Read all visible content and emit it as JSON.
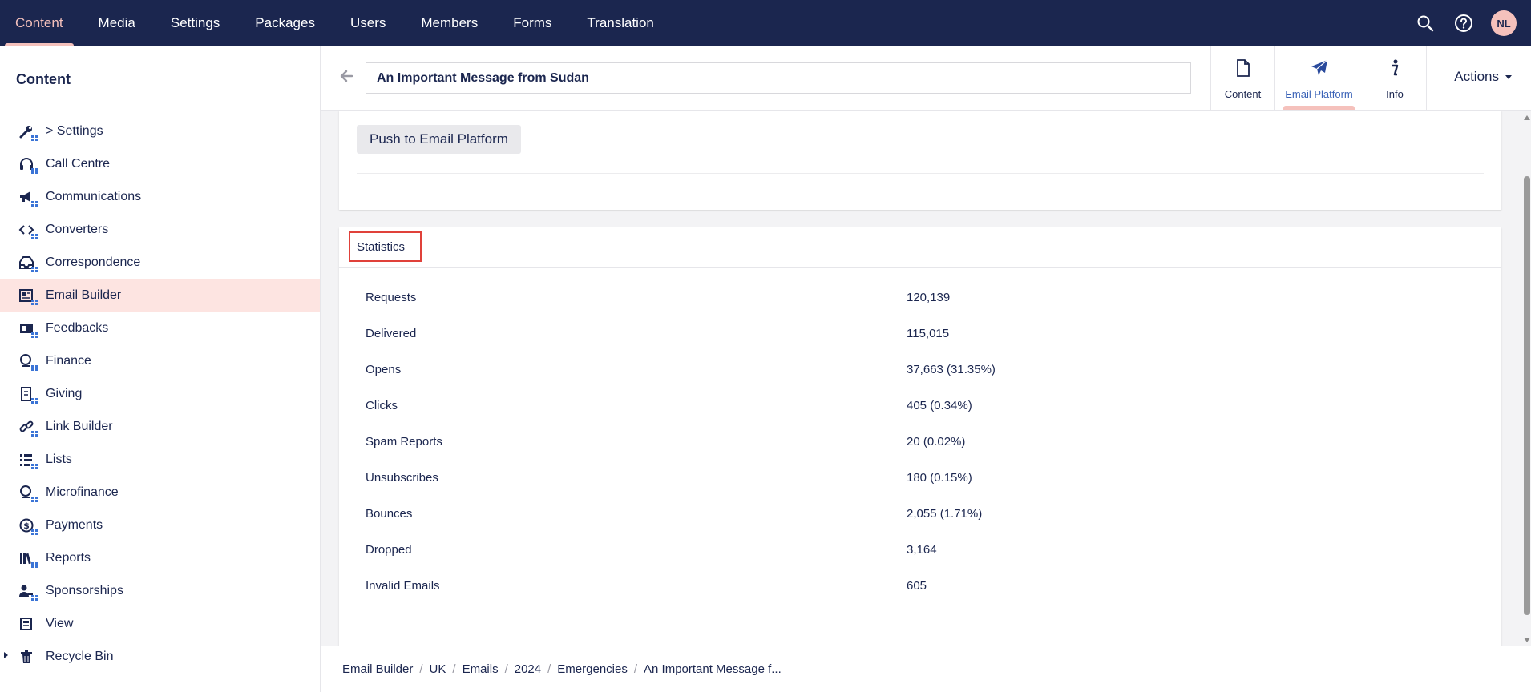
{
  "topnav": {
    "items": [
      {
        "label": "Content",
        "active": true
      },
      {
        "label": "Media"
      },
      {
        "label": "Settings"
      },
      {
        "label": "Packages"
      },
      {
        "label": "Users"
      },
      {
        "label": "Members"
      },
      {
        "label": "Forms"
      },
      {
        "label": "Translation"
      }
    ],
    "user_initials": "NL",
    "icons": [
      "search-icon",
      "help-icon"
    ]
  },
  "sidebar": {
    "title": "Content",
    "items": [
      {
        "label": "> Settings",
        "icon": "wrench-icon"
      },
      {
        "label": "Call Centre",
        "icon": "headset-icon"
      },
      {
        "label": "Communications",
        "icon": "megaphone-icon"
      },
      {
        "label": "Converters",
        "icon": "code-icon"
      },
      {
        "label": "Correspondence",
        "icon": "inbox-icon"
      },
      {
        "label": "Email Builder",
        "icon": "newsletter-icon",
        "selected": true
      },
      {
        "label": "Feedbacks",
        "icon": "feedback-icon"
      },
      {
        "label": "Finance",
        "icon": "coin-icon"
      },
      {
        "label": "Giving",
        "icon": "receipt-icon"
      },
      {
        "label": "Link Builder",
        "icon": "link-icon"
      },
      {
        "label": "Lists",
        "icon": "list-icon"
      },
      {
        "label": "Microfinance",
        "icon": "coin-icon"
      },
      {
        "label": "Payments",
        "icon": "payment-icon"
      },
      {
        "label": "Reports",
        "icon": "books-icon"
      },
      {
        "label": "Sponsorships",
        "icon": "sponsor-icon"
      },
      {
        "label": "View",
        "icon": "document-icon"
      },
      {
        "label": "Recycle Bin",
        "icon": "trash-icon"
      }
    ]
  },
  "editor": {
    "name_value": "An Important Message from Sudan",
    "apps": [
      {
        "label": "Content",
        "icon": "document-icon"
      },
      {
        "label": "Email Platform",
        "icon": "paper-plane-icon",
        "active": true
      },
      {
        "label": "Info",
        "icon": "info-icon"
      }
    ],
    "actions_label": "Actions"
  },
  "panel": {
    "push_label": "Push to Email Platform",
    "stats_title": "Statistics",
    "stats": [
      {
        "label": "Requests",
        "value": "120,139"
      },
      {
        "label": "Delivered",
        "value": "115,015"
      },
      {
        "label": "Opens",
        "value": "37,663 (31.35%)"
      },
      {
        "label": "Clicks",
        "value": "405 (0.34%)"
      },
      {
        "label": "Spam Reports",
        "value": "20 (0.02%)"
      },
      {
        "label": "Unsubscribes",
        "value": "180 (0.15%)"
      },
      {
        "label": "Bounces",
        "value": "2,055 (1.71%)"
      },
      {
        "label": "Dropped",
        "value": "3,164"
      },
      {
        "label": "Invalid Emails",
        "value": "605"
      }
    ]
  },
  "breadcrumb": {
    "links": [
      "Email Builder",
      "UK",
      "Emails",
      "2024",
      "Emergencies"
    ],
    "current": "An Important Message f..."
  },
  "colors": {
    "nav_bg": "#1b264f",
    "accent": "#f5c1bc",
    "selected_bg": "#fde4e1",
    "highlight_border": "#e0413a",
    "badge_blue": "#3b74d6"
  }
}
